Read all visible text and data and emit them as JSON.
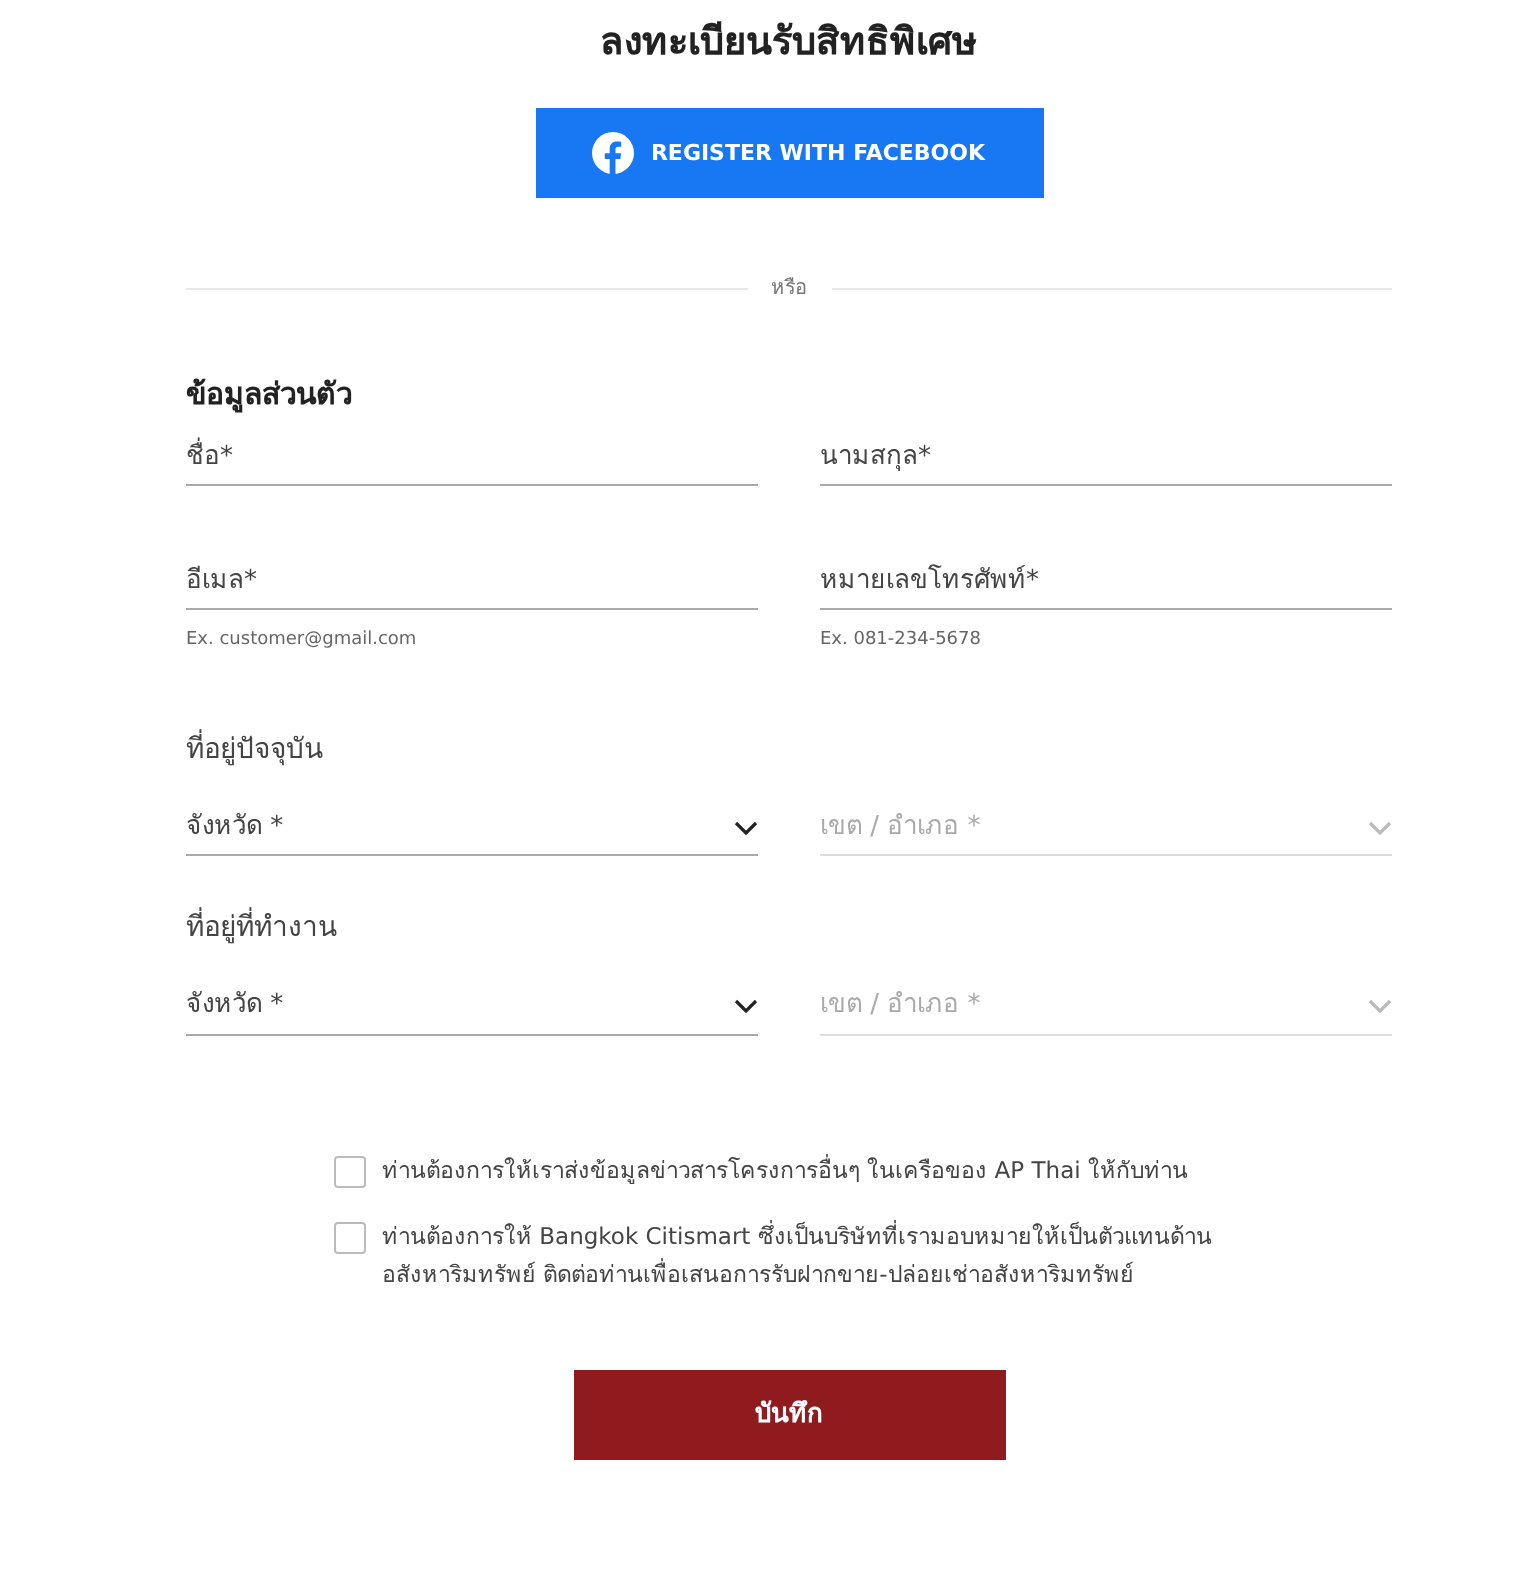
{
  "title": "ลงทะเบียนรับสิทธิพิเศษ",
  "facebook_button": "REGISTER WITH FACEBOOK",
  "divider_text": "หรือ",
  "personal_info": {
    "heading": "ข้อมูลส่วนตัว",
    "rows": [
      [
        {
          "kind": "input",
          "placeholder": "ชื่อ*"
        },
        {
          "kind": "input",
          "placeholder": "นามสกุล*"
        }
      ],
      [
        {
          "kind": "input",
          "placeholder": "อีเมล*",
          "hint": "Ex. customer@gmail.com"
        },
        {
          "kind": "input",
          "placeholder": "หมายเลขโทรศัพท์*",
          "hint": "Ex. 081-234-5678"
        }
      ]
    ]
  },
  "addresses": [
    {
      "heading": "ที่อยู่ปัจจุบัน",
      "fields": [
        {
          "kind": "select",
          "placeholder": "จังหวัด *",
          "disabled": false
        },
        {
          "kind": "select",
          "placeholder": "เขต / อำเภอ *",
          "disabled": true
        }
      ]
    },
    {
      "heading": "ที่อยู่ที่ทำงาน",
      "fields": [
        {
          "kind": "select",
          "placeholder": "จังหวัด *",
          "disabled": false
        },
        {
          "kind": "select",
          "placeholder": "เขต / อำเภอ *",
          "disabled": true
        }
      ]
    }
  ],
  "consents": [
    {
      "label": "ท่านต้องการให้เราส่งข้อมูลข่าวสารโครงการอื่นๆ ในเครือของ AP Thai ให้กับท่าน",
      "checked": false
    },
    {
      "label": "ท่านต้องการให้ Bangkok Citismart ซึ่งเป็นบริษัทที่เรามอบหมายให้เป็นตัวแทนด้านอสังหาริมทรัพย์ ติดต่อท่านเพื่อเสนอการรับฝากขาย-ปล่อยเช่าอสังหาริมทรัพย์",
      "checked": false
    }
  ],
  "save_button": "บันทึก"
}
